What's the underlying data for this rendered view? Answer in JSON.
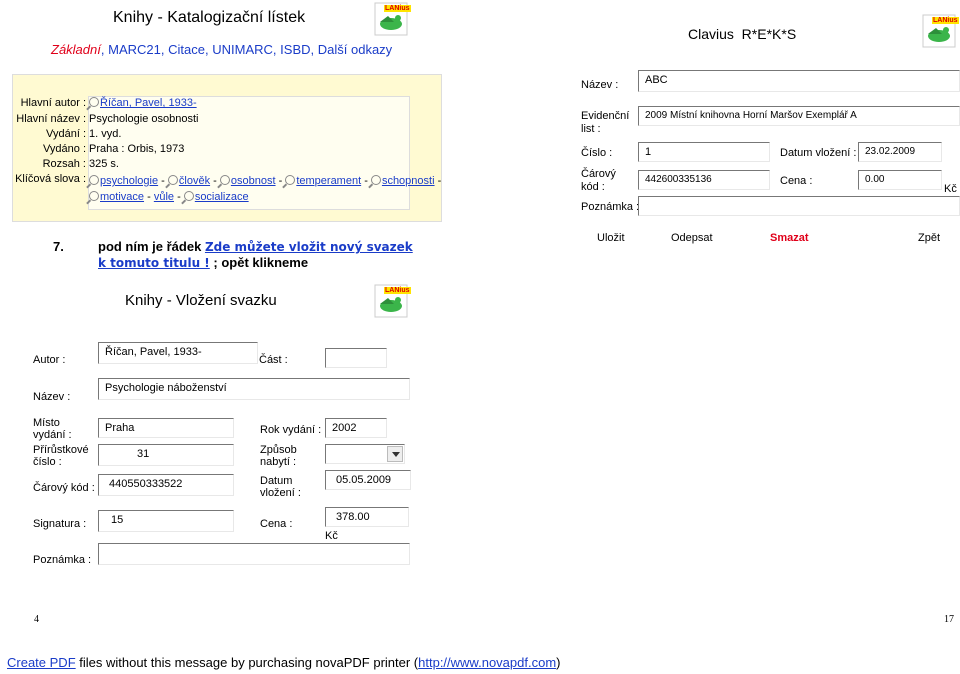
{
  "top": {
    "title": "Knihy - Katalogizační lístek",
    "nav": {
      "zakladni": "Základní",
      "items": [
        "MARC21",
        "Citace",
        "UNIMARC",
        "ISBD",
        "Další odkazy"
      ],
      "sep": ","
    },
    "logo_text": "LANius",
    "right_title": "Clavius  R*E*K*S"
  },
  "catalog": {
    "rows": [
      {
        "label": "Hlavní autor :",
        "value": "Říčan, Pavel, 1933-"
      },
      {
        "label": "Hlavní název :",
        "value": "Psychologie osobnosti"
      },
      {
        "label": "Vydání :",
        "value": "1. vyd."
      },
      {
        "label": "Vydáno :",
        "value": "Praha : Orbis, 1973"
      },
      {
        "label": "Rozsah :",
        "value": "325 s."
      },
      {
        "label": "Klíčová slova :",
        "value": ""
      }
    ],
    "keywords": [
      "psychologie",
      "člověk",
      "osobnost",
      "temperament",
      "schopnosti",
      "motivace",
      "vůle",
      "socializace"
    ],
    "kw_sep": "-"
  },
  "exemplar": {
    "nazev_label": "Název :",
    "nazev_value": "ABC",
    "evid_label_1": "Evidenční",
    "evid_label_2": "list :",
    "evid_value": "2009 Místní knihovna Horní Maršov  Exemplář A",
    "cislo_label": "Číslo :",
    "cislo_value": "1",
    "datum_label": "Datum vložení :",
    "datum_value": "23.02.2009",
    "carovy_label_1": "Čárový",
    "carovy_label_2": "kód :",
    "carovy_value": "442600335136",
    "cena_label": "Cena :",
    "cena_value": "0.00",
    "kc": "Kč",
    "poznamka_label": "Poznámka :",
    "poznamka_value": ""
  },
  "actions": {
    "ulozit": "Uložit",
    "odepsat": "Odepsat",
    "smazat": "Smazat",
    "zpet": "Zpět"
  },
  "instruction": {
    "number": "7.",
    "text1": "pod ním je řádek",
    "link": "Zde můžete vložit nový svazek k tomuto titulu !",
    "text2": "; opět klikneme"
  },
  "form": {
    "title": "Knihy - Vložení svazku",
    "autor_label": "Autor :",
    "autor_value": "Říčan, Pavel, 1933-",
    "cast_label": "Část :",
    "cast_value": "",
    "nazev_label": "Název :",
    "nazev_value": "Psychologie náboženství",
    "misto_label_1": "Místo",
    "misto_label_2": "vydání :",
    "misto_value": "Praha",
    "rok_label": "Rok vydání :",
    "rok_value": "2002",
    "prir_label_1": "Přírůstkové",
    "prir_label_2": "číslo :",
    "prir_value": "31",
    "zpusob_label_1": "Způsob",
    "zpusob_label_2": "nabytí :",
    "zpusob_value": "",
    "carovy_label": "Čárový kód :",
    "carovy_value": "440550333522",
    "datum_label_1": "Datum",
    "datum_label_2": "vložení :",
    "datum_value": "05.05.2009",
    "signatura_label": "Signatura :",
    "signatura_value": "15",
    "cena_label": "Cena :",
    "cena_value": "378.00",
    "kc": "Kč",
    "poznamka_label": "Poznámka :",
    "poznamka_value": ""
  },
  "footer": {
    "page_left": "4",
    "page_right": "17",
    "create_pdf": "Create PDF",
    "mid": " files without this message by purchasing novaPDF printer (",
    "url": "http://www.novapdf.com",
    "end": ")"
  },
  "colors": {
    "link": "#1a3cc8",
    "delete": "#e0001a",
    "panel": "#fffad2"
  }
}
